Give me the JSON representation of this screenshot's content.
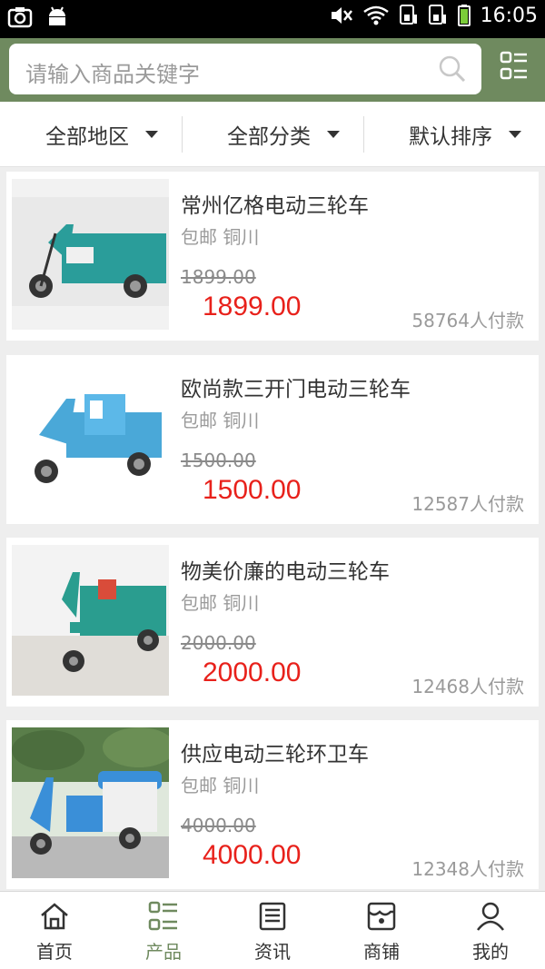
{
  "status_bar": {
    "time": "16:05"
  },
  "search": {
    "placeholder": "请输入商品关键字"
  },
  "filters": [
    {
      "label": "全部地区"
    },
    {
      "label": "全部分类"
    },
    {
      "label": "默认排序"
    }
  ],
  "products": [
    {
      "title": "常州亿格电动三轮车",
      "location": "包邮 铜川",
      "old_price": "1899.00",
      "price": "1899.00",
      "sales": "58764人付款"
    },
    {
      "title": "欧尚款三开门电动三轮车",
      "location": "包邮 铜川",
      "old_price": "1500.00",
      "price": "1500.00",
      "sales": "12587人付款"
    },
    {
      "title": "物美价廉的电动三轮车",
      "location": "包邮 铜川",
      "old_price": "2000.00",
      "price": "2000.00",
      "sales": "12468人付款"
    },
    {
      "title": "供应电动三轮环卫车",
      "location": "包邮 铜川",
      "old_price": "4000.00",
      "price": "4000.00",
      "sales": "12348人付款"
    }
  ],
  "bottom_nav": [
    {
      "label": "首页",
      "icon": "home-icon"
    },
    {
      "label": "产品",
      "icon": "product-grid-icon",
      "active": true
    },
    {
      "label": "资讯",
      "icon": "news-icon"
    },
    {
      "label": "商铺",
      "icon": "store-icon"
    },
    {
      "label": "我的",
      "icon": "profile-icon"
    }
  ],
  "colors": {
    "header_green": "#6f8a5f",
    "price_red": "#e8211b",
    "active_green": "#6f8a5f"
  }
}
